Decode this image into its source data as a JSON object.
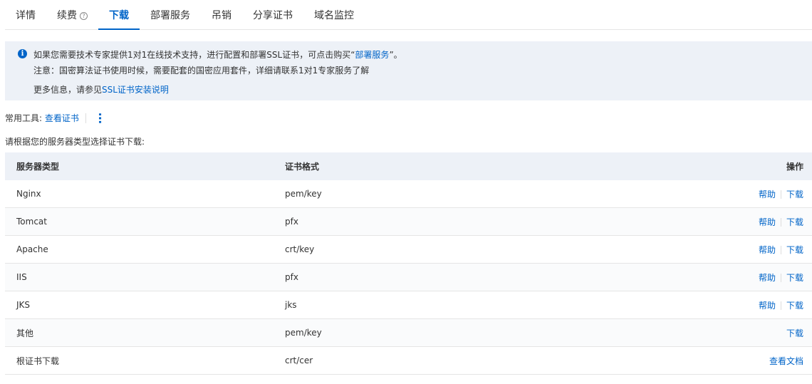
{
  "tabs": [
    {
      "label": "详情"
    },
    {
      "label": "续费",
      "help": "?"
    },
    {
      "label": "下载"
    },
    {
      "label": "部署服务"
    },
    {
      "label": "吊销"
    },
    {
      "label": "分享证书"
    },
    {
      "label": "域名监控"
    }
  ],
  "info": {
    "line1_prefix": "如果您需要技术专家提供1对1在线技术支持，进行配置和部署SSL证书，可点击购买“",
    "line1_link": "部署服务",
    "line1_suffix": "”。",
    "line2": "注意：国密算法证书使用时候，需要配套的国密应用套件，详细请联系1对1专家服务了解",
    "line3_prefix": "更多信息，请参见",
    "line3_link": "SSL证书安装说明"
  },
  "tools": {
    "label": "常用工具:",
    "link": "查看证书"
  },
  "prompt": "请根据您的服务器类型选择证书下载:",
  "table": {
    "headers": [
      "服务器类型",
      "证书格式",
      "操作"
    ],
    "rows": [
      {
        "type": "Nginx",
        "format": "pem/key",
        "help": "帮助",
        "action": "下载"
      },
      {
        "type": "Tomcat",
        "format": "pfx",
        "help": "帮助",
        "action": "下载"
      },
      {
        "type": "Apache",
        "format": "crt/key",
        "help": "帮助",
        "action": "下载"
      },
      {
        "type": "IIS",
        "format": "pfx",
        "help": "帮助",
        "action": "下载"
      },
      {
        "type": "JKS",
        "format": "jks",
        "help": "帮助",
        "action": "下载"
      },
      {
        "type": "其他",
        "format": "pem/key",
        "action": "下载"
      },
      {
        "type": "根证书下载",
        "format": "crt/cer",
        "action": "查看文档"
      }
    ]
  }
}
